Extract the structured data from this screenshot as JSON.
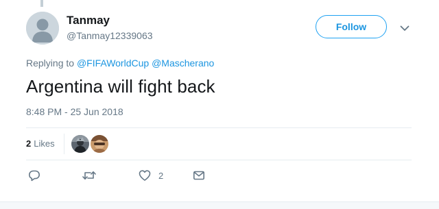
{
  "tweet": {
    "author": {
      "name": "Tanmay",
      "handle": "@Tanmay12339063"
    },
    "follow_label": "Follow",
    "replying_to": {
      "prefix": "Replying to",
      "mentions": [
        "@FIFAWorldCup",
        "@Mascherano"
      ]
    },
    "text": "Argentina will fight back",
    "timestamp": "8:48 PM - 25 Jun 2018",
    "likes": {
      "count": "2",
      "label": "Likes"
    },
    "actions": {
      "reply_count": "",
      "retweet_count": "",
      "like_count": "2"
    }
  },
  "colors": {
    "accent": "#1da1f2",
    "link": "#1b95e0",
    "muted": "#657786",
    "divider": "#e6ecf0",
    "text": "#14171a",
    "avatar_placeholder": "#ccd6dd"
  },
  "icons": {
    "caret": "chevron-down-icon",
    "reply": "reply-icon",
    "retweet": "retweet-icon",
    "like": "heart-icon",
    "message": "envelope-icon"
  }
}
